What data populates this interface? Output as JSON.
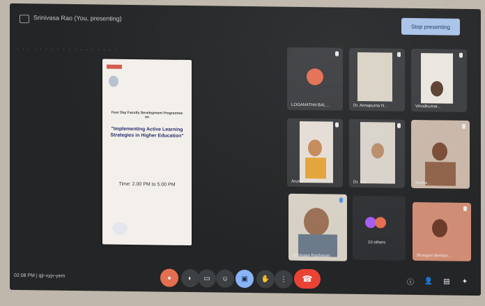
{
  "window": {
    "title": "Srinivasa Rao (You, presenting)",
    "stop_button": "Stop presenting"
  },
  "slide": {
    "org_text": "",
    "subtitle": "",
    "program": "Four Day Faculty Development Programme on",
    "topic": "\"Implementing Active Learning Strategies in Higher Education\"",
    "date_text": "",
    "time_text": "Time: 2.00 PM to 5.00 PM",
    "signatory_left": "",
    "signatory_right": ""
  },
  "participants": [
    {
      "name": "LOGANATHA BAL..."
    },
    {
      "name": "Dr. Annapurna N..."
    },
    {
      "name": "Vinodkumar..."
    },
    {
      "name": "Aruna..."
    },
    {
      "name": "Dr. Sai..."
    },
    {
      "name": "Anitha..."
    },
    {
      "name": "Srinivasa Raghavan"
    },
    {
      "name": "10 others"
    },
    {
      "name": "Bhargavi Bendar..."
    }
  ],
  "controls": {
    "clock": "02:08 PM | qjr-xyjv-yem",
    "mic_icon": "mic-icon",
    "camera_icon": "camera-icon",
    "captions_icon": "captions-icon",
    "emoji_icon": "emoji-icon",
    "present_icon": "present-icon",
    "hand_icon": "raise-hand-icon",
    "more_icon": "more-icon",
    "end_icon": "end-call-icon"
  },
  "colors": {
    "end_call": "#ea4335",
    "stop_button": "#a8c3e8",
    "avatar": "#e46e50"
  }
}
